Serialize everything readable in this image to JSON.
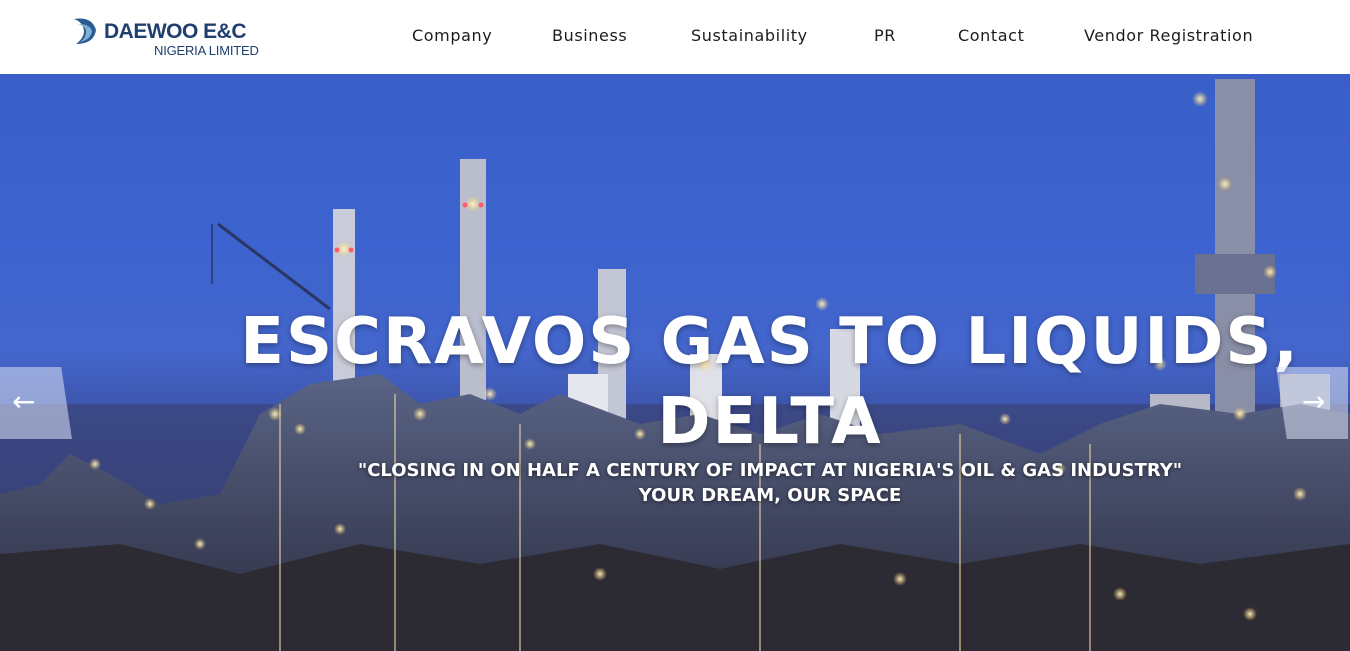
{
  "brand": {
    "name": "DAEWOO E&C",
    "subtitle": "NIGERIA LIMITED",
    "color": "#1f3f6e"
  },
  "nav": {
    "company": "Company",
    "business": "Business",
    "sustainability": "Sustainability",
    "pr": "PR",
    "contact": "Contact",
    "vendor": "Vendor Registration"
  },
  "hero": {
    "title_line1": "ESCRAVOS GAS TO LIQUIDS,",
    "title_line2": "DELTA",
    "tagline": "\"CLOSING IN ON HALF A CENTURY OF IMPACT AT NIGERIA'S OIL & GAS INDUSTRY\"",
    "slogan": "YOUR DREAM, OUR SPACE",
    "prev_icon": "arrow-left-icon",
    "next_icon": "arrow-right-icon"
  },
  "colors": {
    "sky": "#3c63cf",
    "text": "#ffffff",
    "nav_text": "#1c1c1c"
  }
}
